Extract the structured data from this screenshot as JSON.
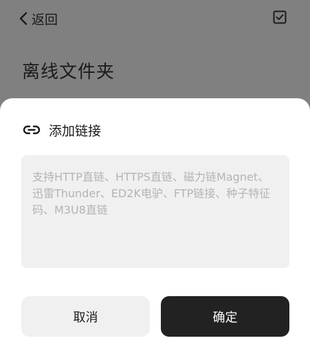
{
  "header": {
    "back_label": "返回",
    "select_icon": "checkbox-icon"
  },
  "page": {
    "title": "离线文件夹"
  },
  "dialog": {
    "title": "添加链接",
    "icon": "link-icon",
    "input": {
      "value": "",
      "placeholder": "支持HTTP直链、HTTPS直链、磁力链Magnet、迅雷Thunder、ED2K电驴、FTP链接、种子特征码、M3U8直链"
    },
    "cancel_label": "取消",
    "confirm_label": "确定"
  },
  "colors": {
    "overlay": "#808080",
    "sheet": "#ffffff",
    "input_bg": "#f0f0f0",
    "confirm_bg": "#222222"
  }
}
